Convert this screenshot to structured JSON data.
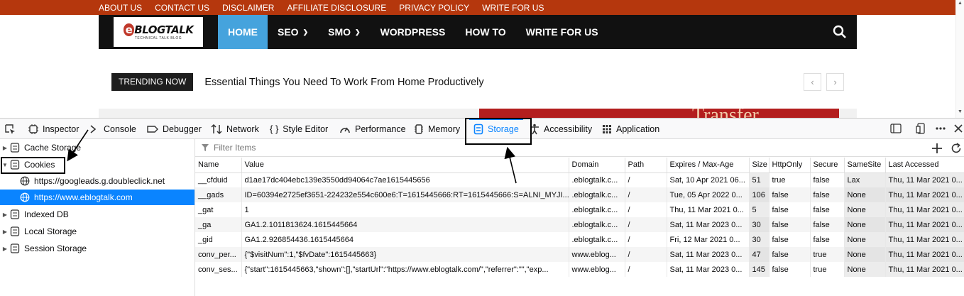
{
  "site": {
    "top_links": [
      "ABOUT US",
      "CONTACT US",
      "DISCLAIMER",
      "AFFILIATE DISCLOSURE",
      "PRIVACY POLICY",
      "WRITE FOR US"
    ],
    "logo_text": "BLOGTALK",
    "logo_letter": "e",
    "logo_tagline": "TECHNICAL TALK BLOG",
    "nav": [
      {
        "label": "HOME",
        "active": true,
        "dropdown": false
      },
      {
        "label": "SEO",
        "active": false,
        "dropdown": true
      },
      {
        "label": "SMO",
        "active": false,
        "dropdown": true
      },
      {
        "label": "WORDPRESS",
        "active": false,
        "dropdown": false
      },
      {
        "label": "HOW TO",
        "active": false,
        "dropdown": false
      },
      {
        "label": "WRITE FOR US",
        "active": false,
        "dropdown": false
      }
    ],
    "trending_label": "TRENDING NOW",
    "trending_title": "Essential Things You Need To Work From Home Productively",
    "pager_prev": "‹",
    "pager_next": "›",
    "banner_text": "Transfer",
    "colors": {
      "topbar": "#b5370d",
      "nav_active": "#45a3dd"
    }
  },
  "devtools": {
    "tabs": [
      {
        "label": "Inspector",
        "icon": "inspector-icon"
      },
      {
        "label": "Console",
        "icon": "console-icon"
      },
      {
        "label": "Debugger",
        "icon": "debugger-icon"
      },
      {
        "label": "Network",
        "icon": "network-icon"
      },
      {
        "label": "Style Editor",
        "icon": "style-editor-icon"
      },
      {
        "label": "Performance",
        "icon": "performance-icon"
      },
      {
        "label": "Memory",
        "icon": "memory-icon"
      },
      {
        "label": "Storage",
        "icon": "storage-icon",
        "active": true
      },
      {
        "label": "Accessibility",
        "icon": "accessibility-icon"
      },
      {
        "label": "Application",
        "icon": "application-icon"
      }
    ],
    "sidebar": [
      {
        "label": "Cache Storage",
        "expanded": false
      },
      {
        "label": "Cookies",
        "expanded": true
      },
      {
        "label": "https://googleads.g.doubleclick.net",
        "child": true
      },
      {
        "label": "https://www.eblogtalk.com",
        "child": true,
        "selected": true
      },
      {
        "label": "Indexed DB",
        "expanded": false
      },
      {
        "label": "Local Storage",
        "expanded": false
      },
      {
        "label": "Session Storage",
        "expanded": false
      }
    ],
    "filter_placeholder": "Filter Items",
    "columns": [
      "Name",
      "Value",
      "Domain",
      "Path",
      "Expires / Max-Age",
      "Size",
      "HttpOnly",
      "Secure",
      "SameSite",
      "Last Accessed"
    ],
    "rows": [
      [
        "__cfduid",
        "d1ae17dc404ebc139e3550dd94064c7ae1615445656",
        ".eblogtalk.c...",
        "/",
        "Sat, 10 Apr 2021 06...",
        "51",
        "true",
        "false",
        "Lax",
        "Thu, 11 Mar 2021 0..."
      ],
      [
        "__gads",
        "ID=60394e2725ef3651-224232e554c600e6:T=1615445666:RT=1615445666:S=ALNI_MYJI...",
        ".eblogtalk.c...",
        "/",
        "Tue, 05 Apr 2022 0...",
        "106",
        "false",
        "false",
        "None",
        "Thu, 11 Mar 2021 0..."
      ],
      [
        "_gat",
        "1",
        ".eblogtalk.c...",
        "/",
        "Thu, 11 Mar 2021 0...",
        "5",
        "false",
        "false",
        "None",
        "Thu, 11 Mar 2021 0..."
      ],
      [
        "_ga",
        "GA1.2.1011813624.1615445664",
        ".eblogtalk.c...",
        "/",
        "Sat, 11 Mar 2023 0...",
        "30",
        "false",
        "false",
        "None",
        "Thu, 11 Mar 2021 0..."
      ],
      [
        "_gid",
        "GA1.2.926854436.1615445664",
        ".eblogtalk.c...",
        "/",
        "Fri, 12 Mar 2021 0...",
        "30",
        "false",
        "false",
        "None",
        "Thu, 11 Mar 2021 0..."
      ],
      [
        "conv_per...",
        "{\"$visitNum\":1,\"$fvDate\":1615445663}",
        "www.eblog...",
        "/",
        "Sat, 11 Mar 2023 0...",
        "47",
        "false",
        "true",
        "None",
        "Thu, 11 Mar 2021 0..."
      ],
      [
        "conv_ses...",
        "{\"start\":1615445663,\"shown\":[],\"startUrl\":\"https://www.eblogtalk.com/\",\"referrer\":\"\",\"exp...",
        "www.eblog...",
        "/",
        "Sat, 11 Mar 2023 0...",
        "145",
        "false",
        "true",
        "None",
        "Thu, 11 Mar 2021 0..."
      ]
    ],
    "accent": "#0a84ff"
  }
}
